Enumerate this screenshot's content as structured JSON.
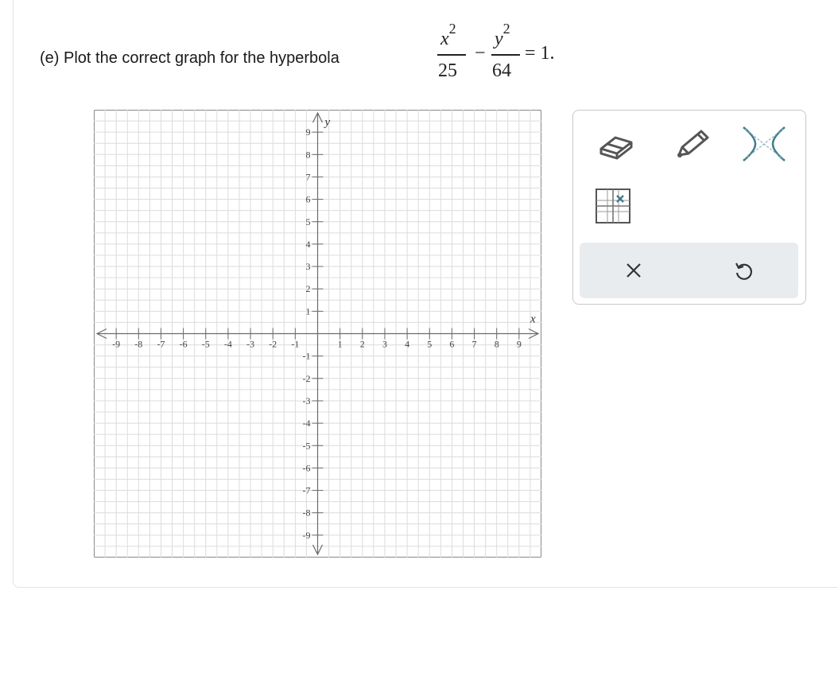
{
  "question": {
    "prompt": "(e) Plot the correct graph for the hyperbola",
    "equation": {
      "term1_var": "x",
      "term1_exp": "2",
      "term1_den": "25",
      "minus": "−",
      "term2_var": "y",
      "term2_exp": "2",
      "term2_den": "64",
      "rhs": "= 1."
    }
  },
  "graph": {
    "x_axis_label": "x",
    "y_axis_label": "y",
    "x_range": [
      -10,
      10
    ],
    "y_range": [
      -10,
      10
    ],
    "x_ticks": [
      "-9",
      "-8",
      "-7",
      "-6",
      "-5",
      "-4",
      "-3",
      "-2",
      "-1",
      "1",
      "2",
      "3",
      "4",
      "5",
      "6",
      "7",
      "8",
      "9"
    ],
    "y_ticks": [
      "9",
      "8",
      "7",
      "6",
      "5",
      "4",
      "3",
      "2",
      "1",
      "-1",
      "-2",
      "-3",
      "-4",
      "-5",
      "-6",
      "-7",
      "-8",
      "-9"
    ],
    "grid": true
  },
  "tools": {
    "eraser": "eraser-icon",
    "pencil": "pencil-icon",
    "hyperbola": "hyperbola-icon",
    "point_select": "grid-point-icon"
  },
  "actions": {
    "clear": "close-icon",
    "undo": "undo-icon"
  },
  "colors": {
    "grid": "#dcdcdc",
    "axis": "#6b6b6b",
    "tool_icon": "#555555",
    "accent": "#3f7b8c",
    "action_bar": "#e9ecef"
  }
}
